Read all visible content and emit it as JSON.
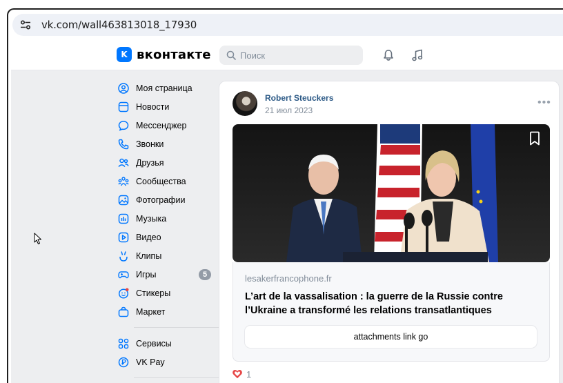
{
  "browser": {
    "url": "vk.com/wall463813018_17930"
  },
  "header": {
    "logo_text": "вконтакте",
    "logo_mark": "K",
    "search_placeholder": "Поиск",
    "icons": [
      "bell-icon",
      "music-icon"
    ]
  },
  "sidebar": {
    "items": [
      {
        "label": "Моя страница",
        "icon": "user-circle-icon"
      },
      {
        "label": "Новости",
        "icon": "news-icon"
      },
      {
        "label": "Мессенджер",
        "icon": "message-icon"
      },
      {
        "label": "Звонки",
        "icon": "phone-icon"
      },
      {
        "label": "Друзья",
        "icon": "friends-icon"
      },
      {
        "label": "Сообщества",
        "icon": "communities-icon"
      },
      {
        "label": "Фотографии",
        "icon": "photo-icon"
      },
      {
        "label": "Музыка",
        "icon": "music-icon"
      },
      {
        "label": "Видео",
        "icon": "video-icon"
      },
      {
        "label": "Клипы",
        "icon": "clips-icon"
      },
      {
        "label": "Игры",
        "icon": "games-icon",
        "badge": "5"
      },
      {
        "label": "Стикеры",
        "icon": "stickers-icon"
      },
      {
        "label": "Маркет",
        "icon": "market-icon"
      }
    ],
    "extra_items": [
      {
        "label": "Сервисы",
        "icon": "services-icon"
      },
      {
        "label": "VK Pay",
        "icon": "vkpay-icon"
      }
    ]
  },
  "post": {
    "author": "Robert Steuckers",
    "date": "21 июл 2023",
    "more": "•••",
    "link": {
      "domain": "lesakerfrancophone.fr",
      "title": "L’art de la vassalisation : la guerre de la Russie contre l’Ukraine a transformé les relations transatlantiques",
      "button": "attachments link go"
    },
    "likes_count": "1"
  },
  "colors": {
    "accent": "#0077ff",
    "link": "#2a5885",
    "background": "#edeef0",
    "like": "#e64646"
  }
}
